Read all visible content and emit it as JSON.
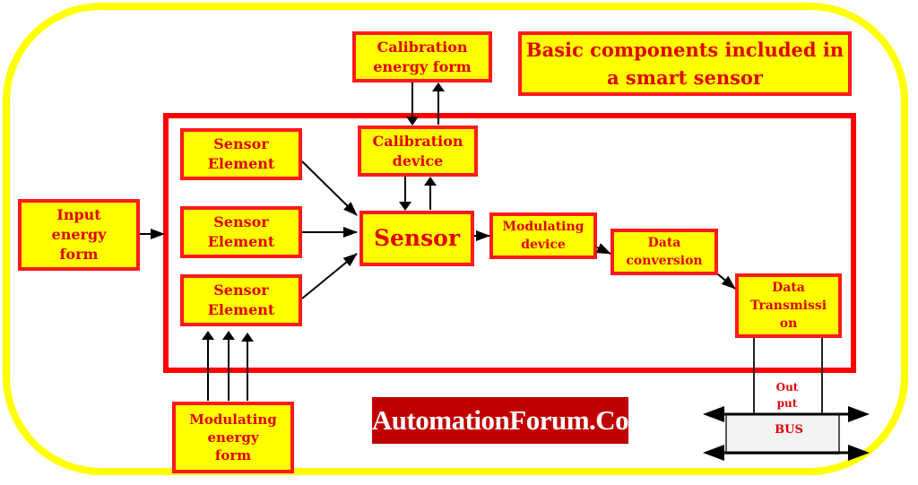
{
  "diagram": {
    "title": "Basic components included in a smart sensor",
    "watermark": "AutomationForum.Co",
    "colors": {
      "frame": "#ffff00",
      "box_fill": "#ffff00",
      "box_border": "#ff1a1a",
      "text": "#e00000",
      "system_border": "#ff0000",
      "watermark_bg": "#c00000",
      "arrow": "#000000"
    },
    "nodes": {
      "input_energy": "Input\nenergy\nform",
      "sensor_element_1": "Sensor\nElement",
      "sensor_element_2": "Sensor\nElement",
      "sensor_element_3": "Sensor\nElement",
      "calibration_energy": "Calibration\nenergy form",
      "calibration_device": "Calibration\ndevice",
      "sensor": "Sensor",
      "modulating_device": "Modulating\ndevice",
      "data_conversion": "Data\nconversion",
      "data_transmission": "Data\nTransmissi\non",
      "modulating_energy": "Modulating\nenergy\nform",
      "output": "Out\nput",
      "bus": "BUS"
    },
    "edges": [
      {
        "from": "input_energy",
        "to": "system"
      },
      {
        "from": "sensor_element_1",
        "to": "sensor"
      },
      {
        "from": "sensor_element_2",
        "to": "sensor"
      },
      {
        "from": "sensor_element_3",
        "to": "sensor"
      },
      {
        "from": "calibration_energy",
        "to": "calibration_device"
      },
      {
        "from": "calibration_device",
        "to": "calibration_energy"
      },
      {
        "from": "calibration_device",
        "to": "sensor"
      },
      {
        "from": "sensor",
        "to": "calibration_device"
      },
      {
        "from": "sensor",
        "to": "modulating_device"
      },
      {
        "from": "modulating_device",
        "to": "data_conversion"
      },
      {
        "from": "data_conversion",
        "to": "data_transmission"
      },
      {
        "from": "modulating_energy",
        "to": "sensor_element_3"
      },
      {
        "from": "data_transmission",
        "to": "bus"
      }
    ]
  }
}
